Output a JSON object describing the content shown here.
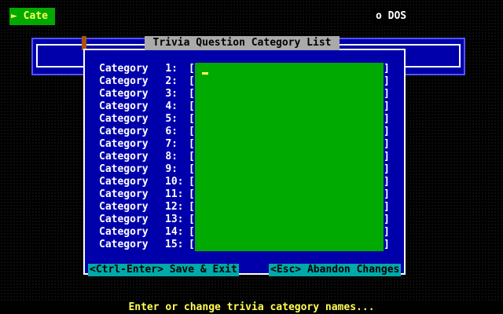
{
  "menu": {
    "categories_label": "► Cate",
    "dos_label": "o DOS"
  },
  "dialog": {
    "title": "Trivia Question Category List",
    "rows": [
      {
        "label": "Category",
        "num": "1:",
        "value": ""
      },
      {
        "label": "Category",
        "num": "2:",
        "value": ""
      },
      {
        "label": "Category",
        "num": "3:",
        "value": ""
      },
      {
        "label": "Category",
        "num": "4:",
        "value": ""
      },
      {
        "label": "Category",
        "num": "5:",
        "value": ""
      },
      {
        "label": "Category",
        "num": "6:",
        "value": ""
      },
      {
        "label": "Category",
        "num": "7:",
        "value": ""
      },
      {
        "label": "Category",
        "num": "8:",
        "value": ""
      },
      {
        "label": "Category",
        "num": "9:",
        "value": ""
      },
      {
        "label": "Category",
        "num": "10:",
        "value": ""
      },
      {
        "label": "Category",
        "num": "11:",
        "value": ""
      },
      {
        "label": "Category",
        "num": "12:",
        "value": ""
      },
      {
        "label": "Category",
        "num": "13:",
        "value": ""
      },
      {
        "label": "Category",
        "num": "14:",
        "value": ""
      },
      {
        "label": "Category",
        "num": "15:",
        "value": ""
      }
    ],
    "save_button": "<Ctrl-Enter> Save & Exit",
    "abandon_button": "<Esc> Abandon Changes"
  },
  "status_bar": "Enter or change trivia category names...",
  "colors": {
    "background": "#000000",
    "window": "#0000aa",
    "edit_field": "#00aa00",
    "highlight_text": "#ffff55",
    "button": "#00aaaa"
  }
}
